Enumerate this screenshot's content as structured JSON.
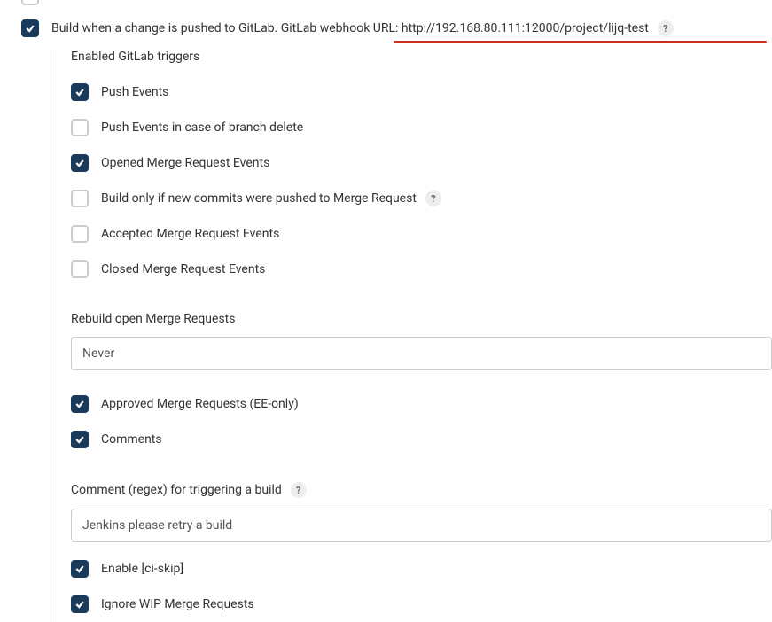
{
  "topPartial": {
    "checked": false
  },
  "main": {
    "label": "Build when a change is pushed to GitLab. GitLab webhook URL: http://192.168.80.111:12000/project/lijq-test",
    "checked": true
  },
  "enabled_triggers_title": "Enabled GitLab triggers",
  "triggers": {
    "push": {
      "label": "Push Events",
      "checked": true
    },
    "push_delete": {
      "label": "Push Events in case of branch delete",
      "checked": false
    },
    "opened_mr": {
      "label": "Opened Merge Request Events",
      "checked": true
    },
    "build_new_commits": {
      "label": "Build only if new commits were pushed to Merge Request",
      "checked": false,
      "help": true
    },
    "accepted_mr": {
      "label": "Accepted Merge Request Events",
      "checked": false
    },
    "closed_mr": {
      "label": "Closed Merge Request Events",
      "checked": false
    }
  },
  "rebuild": {
    "label": "Rebuild open Merge Requests",
    "value": "Never"
  },
  "post_rebuild": {
    "approved_mr": {
      "label": "Approved Merge Requests (EE-only)",
      "checked": true
    },
    "comments": {
      "label": "Comments",
      "checked": true
    }
  },
  "comment_regex": {
    "label": "Comment (regex) for triggering a build",
    "value": "Jenkins please retry a build",
    "help": true
  },
  "bottom": {
    "ci_skip": {
      "label": "Enable [ci-skip]",
      "checked": true
    },
    "ignore_wip": {
      "label": "Ignore WIP Merge Requests",
      "checked": true
    }
  }
}
